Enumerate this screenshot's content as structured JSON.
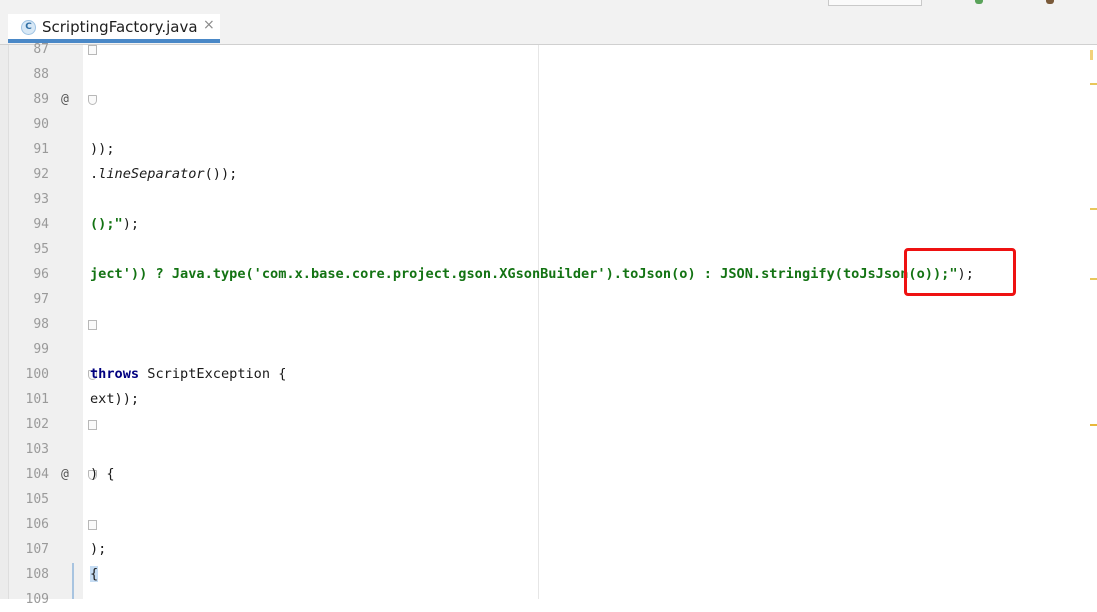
{
  "window": {
    "tab": {
      "icon": "class-c-icon",
      "title": "ScriptingFactory.java",
      "close": "×"
    }
  },
  "editor": {
    "lines": [
      {
        "n": "87",
        "mark": ""
      },
      {
        "n": "88",
        "mark": ""
      },
      {
        "n": "89",
        "mark": "@"
      },
      {
        "n": "90",
        "mark": ""
      },
      {
        "n": "91",
        "mark": ""
      },
      {
        "n": "92",
        "mark": ""
      },
      {
        "n": "93",
        "mark": ""
      },
      {
        "n": "94",
        "mark": ""
      },
      {
        "n": "95",
        "mark": ""
      },
      {
        "n": "96",
        "mark": ""
      },
      {
        "n": "97",
        "mark": ""
      },
      {
        "n": "98",
        "mark": ""
      },
      {
        "n": "99",
        "mark": ""
      },
      {
        "n": "100",
        "mark": ""
      },
      {
        "n": "101",
        "mark": ""
      },
      {
        "n": "102",
        "mark": ""
      },
      {
        "n": "103",
        "mark": ""
      },
      {
        "n": "104",
        "mark": "@"
      },
      {
        "n": "105",
        "mark": ""
      },
      {
        "n": "106",
        "mark": ""
      },
      {
        "n": "107",
        "mark": ""
      },
      {
        "n": "108",
        "mark": ""
      },
      {
        "n": "109",
        "mark": ""
      }
    ],
    "code": {
      "l91": "));",
      "l92_dot": ".",
      "l92_call": "lineSeparator",
      "l92_end": "());",
      "l94_str": "();\"",
      "l94_end": ");",
      "l96_a": "ject')) ? Java.type('com.x.base.core.project.gson.XGsonBuilder').toJson(o) : JSON.stringify",
      "l96_b": "(toJsJson(o)",
      "l96_c": ");\"",
      "l96_d": ");",
      "l100_kw": "throws",
      "l100_rest": " ScriptException {",
      "l101": "ext));",
      "l104": ") {",
      "l107": ");",
      "l108": "{"
    }
  },
  "annotation": {
    "type": "highlight-box",
    "target": "toJsJson(o)",
    "color": "#ee1111"
  },
  "colors": {
    "string": "#137313",
    "keyword": "#000080",
    "tab_underline": "#4a88c7"
  }
}
